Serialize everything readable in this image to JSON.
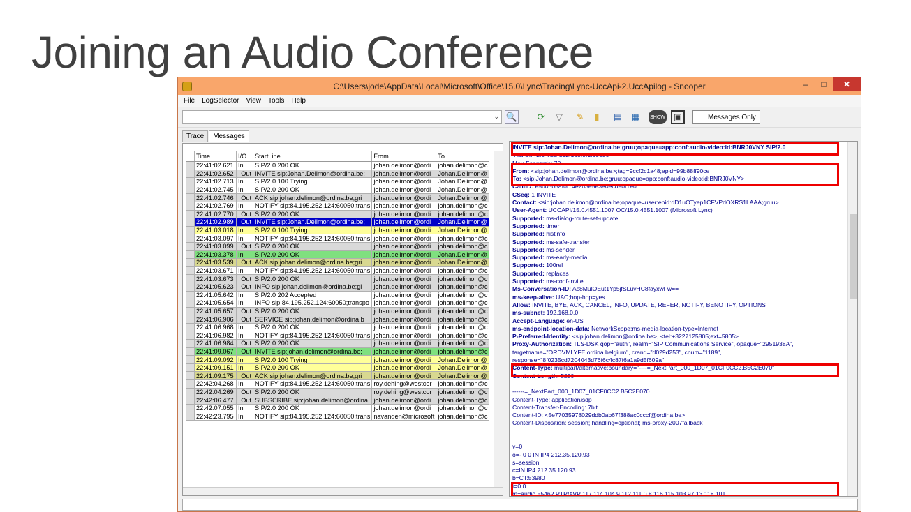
{
  "slide": {
    "title": "Joining an Audio Conference"
  },
  "window": {
    "title": "C:\\Users\\jode\\AppData\\Local\\Microsoft\\Office\\15.0\\Lync\\Tracing\\Lync-UccApi-2.UccApilog - Snooper",
    "minimize": "–",
    "maximize": "□",
    "close": "✕"
  },
  "menu": [
    "File",
    "LogSelector",
    "View",
    "Tools",
    "Help"
  ],
  "toolbar": {
    "messages_only": "Messages Only"
  },
  "tabs": [
    "Trace",
    "Messages"
  ],
  "grid": {
    "columns": [
      "Time",
      "I/O",
      "StartLine",
      "From",
      "To"
    ],
    "rows": [
      {
        "time": "22:41:02.621",
        "io": "In",
        "start": "SIP/2.0 200 OK",
        "from": "johan.delimon@ordi",
        "to": "johan.delimon@c",
        "style": "white"
      },
      {
        "time": "22:41:02.652",
        "io": "Out",
        "start": "INVITE sip:Johan.Delimon@ordina.be;",
        "from": "johan.delimon@ordi",
        "to": "Johan.Delimon@",
        "style": "gray"
      },
      {
        "time": "22:41:02.713",
        "io": "In",
        "start": "SIP/2.0 100 Trying",
        "from": "johan.delimon@ordi",
        "to": "Johan.Delimon@",
        "style": "white"
      },
      {
        "time": "22:41:02.745",
        "io": "In",
        "start": "SIP/2.0 200 OK",
        "from": "johan.delimon@ordi",
        "to": "Johan.Delimon@",
        "style": "white"
      },
      {
        "time": "22:41:02.746",
        "io": "Out",
        "start": "ACK sip:johan.delimon@ordina.be;gri",
        "from": "johan.delimon@ordi",
        "to": "Johan.Delimon@",
        "style": "gray"
      },
      {
        "time": "22:41:02.769",
        "io": "In",
        "start": "NOTIFY sip:84.195.252.124:60050;trans",
        "from": "johan.delimon@ordi",
        "to": "johan.delimon@c",
        "style": "white"
      },
      {
        "time": "22:41:02.770",
        "io": "Out",
        "start": "SIP/2.0 200 OK",
        "from": "johan.delimon@ordi",
        "to": "johan.delimon@c",
        "style": "gray"
      },
      {
        "time": "22:41:02.989",
        "io": "Out",
        "start": "INVITE sip:Johan.Delimon@ordina.be;",
        "from": "johan.delimon@ordi",
        "to": "Johan.Delimon@",
        "style": "blue"
      },
      {
        "time": "22:41:03.018",
        "io": "In",
        "start": "SIP/2.0 100 Trying",
        "from": "johan.delimon@ordi",
        "to": "Johan.Delimon@",
        "style": "yellow"
      },
      {
        "time": "22:41:03.097",
        "io": "In",
        "start": "NOTIFY sip:84.195.252.124:60050;trans",
        "from": "johan.delimon@ordi",
        "to": "johan.delimon@c",
        "style": "white"
      },
      {
        "time": "22:41:03.099",
        "io": "Out",
        "start": "SIP/2.0 200 OK",
        "from": "johan.delimon@ordi",
        "to": "johan.delimon@c",
        "style": "gray"
      },
      {
        "time": "22:41:03.378",
        "io": "In",
        "start": "SIP/2.0 200 OK",
        "from": "johan.delimon@ordi",
        "to": "Johan.Delimon@",
        "style": "green"
      },
      {
        "time": "22:41:03.539",
        "io": "Out",
        "start": "ACK sip:johan.delimon@ordina.be;gri",
        "from": "johan.delimon@ordi",
        "to": "Johan.Delimon@",
        "style": "khaki"
      },
      {
        "time": "22:41:03.671",
        "io": "In",
        "start": "NOTIFY sip:84.195.252.124:60050;trans",
        "from": "johan.delimon@ordi",
        "to": "johan.delimon@c",
        "style": "white"
      },
      {
        "time": "22:41:03.673",
        "io": "Out",
        "start": "SIP/2.0 200 OK",
        "from": "johan.delimon@ordi",
        "to": "johan.delimon@c",
        "style": "gray"
      },
      {
        "time": "22:41:05.623",
        "io": "Out",
        "start": "INFO sip:johan.delimon@ordina.be;gi",
        "from": "johan.delimon@ordi",
        "to": "johan.delimon@c",
        "style": "gray"
      },
      {
        "time": "22:41:05.642",
        "io": "In",
        "start": "SIP/2.0 202 Accepted",
        "from": "johan.delimon@ordi",
        "to": "johan.delimon@c",
        "style": "white"
      },
      {
        "time": "22:41:05.654",
        "io": "In",
        "start": "INFO sip:84.195.252.124:60050;transpo",
        "from": "johan.delimon@ordi",
        "to": "johan.delimon@c",
        "style": "white"
      },
      {
        "time": "22:41:05.657",
        "io": "Out",
        "start": "SIP/2.0 200 OK",
        "from": "johan.delimon@ordi",
        "to": "johan.delimon@c",
        "style": "gray"
      },
      {
        "time": "22:41:06.906",
        "io": "Out",
        "start": "SERVICE sip:johan.delimon@ordina.b",
        "from": "johan.delimon@ordi",
        "to": "johan.delimon@c",
        "style": "gray"
      },
      {
        "time": "22:41:06.968",
        "io": "In",
        "start": "SIP/2.0 200 OK",
        "from": "johan.delimon@ordi",
        "to": "johan.delimon@c",
        "style": "white"
      },
      {
        "time": "22:41:06.982",
        "io": "In",
        "start": "NOTIFY sip:84.195.252.124:60050;trans",
        "from": "johan.delimon@ordi",
        "to": "johan.delimon@c",
        "style": "white"
      },
      {
        "time": "22:41:06.984",
        "io": "Out",
        "start": "SIP/2.0 200 OK",
        "from": "johan.delimon@ordi",
        "to": "johan.delimon@c",
        "style": "gray"
      },
      {
        "time": "22:41:09.067",
        "io": "Out",
        "start": "INVITE sip:johan.delimon@ordina.be;",
        "from": "johan.delimon@ordi",
        "to": "johan.delimon@c",
        "style": "green"
      },
      {
        "time": "22:41:09.092",
        "io": "In",
        "start": "SIP/2.0 100 Trying",
        "from": "johan.delimon@ordi",
        "to": "Johan.Delimon@",
        "style": "yellow"
      },
      {
        "time": "22:41:09.151",
        "io": "In",
        "start": "SIP/2.0 200 OK",
        "from": "johan.delimon@ordi",
        "to": "Johan.Delimon@",
        "style": "yellow"
      },
      {
        "time": "22:41:09.175",
        "io": "Out",
        "start": "ACK sip:johan.delimon@ordina.be;gri",
        "from": "johan.delimon@ordi",
        "to": "Johan.Delimon@",
        "style": "khaki"
      },
      {
        "time": "22:42:04.268",
        "io": "In",
        "start": "NOTIFY sip:84.195.252.124:60050;trans",
        "from": "roy.dehing@westcor",
        "to": "johan.delimon@c",
        "style": "white"
      },
      {
        "time": "22:42:04.269",
        "io": "Out",
        "start": "SIP/2.0 200 OK",
        "from": "roy.dehing@westcor",
        "to": "johan.delimon@c",
        "style": "gray"
      },
      {
        "time": "22:42:06.477",
        "io": "Out",
        "start": "SUBSCRIBE sip:johan.delimon@ordina",
        "from": "johan.delimon@ordi",
        "to": "johan.delimon@c",
        "style": "gray"
      },
      {
        "time": "22:42:07.055",
        "io": "In",
        "start": "SIP/2.0 200 OK",
        "from": "johan.delimon@ordi",
        "to": "johan.delimon@c",
        "style": "white"
      },
      {
        "time": "22:42:23.795",
        "io": "In",
        "start": "NOTIFY sip:84.195.252.124:60050;trans",
        "from": "navanden@microsoft",
        "to": "johan.delimon@c",
        "style": "white"
      }
    ]
  },
  "detail": {
    "lines": [
      {
        "k": "INVITE sip:Johan.Delimon@ordina.be;gruu;opaque=app:conf:audio-video:id:BNRJ0VNY SIP/2.0",
        "v": ""
      },
      {
        "k": "Via:",
        "v": " SIP/2.0/TLS 192.168.0.1:60050"
      },
      {
        "k": "",
        "v": "Max-Forwards: 70"
      },
      {
        "k": "From:",
        "v": " <sip:johan.delimon@ordina.be>;tag=9ccf2c1a48;epid=99b88ff90ce"
      },
      {
        "k": "To:",
        "v": " <sip:Johan.Delimon@ordina.be;gruu;opaque=app:conf:audio-video:id:BNRJ0VNY>"
      },
      {
        "k": "Call-ID:",
        "v": " e5b0305af0f74e2d3e5e3e0ec0e0f1e0"
      },
      {
        "k": "CSeq:",
        "v": " 1 INVITE"
      },
      {
        "k": "Contact:",
        "v": " <sip:johan.delimon@ordina.be;opaque=user:epid:dD1uOTyep1CFVPdOXRS1LAAA;gruu>"
      },
      {
        "k": "User-Agent:",
        "v": " UCCAPI/15.0.4551.1007 OC/15.0.4551.1007 (Microsoft Lync)"
      },
      {
        "k": "Supported:",
        "v": " ms-dialog-route-set-update"
      },
      {
        "k": "Supported:",
        "v": " timer"
      },
      {
        "k": "Supported:",
        "v": " histinfo"
      },
      {
        "k": "Supported:",
        "v": " ms-safe-transfer"
      },
      {
        "k": "Supported:",
        "v": " ms-sender"
      },
      {
        "k": "Supported:",
        "v": " ms-early-media"
      },
      {
        "k": "Supported:",
        "v": " 100rel"
      },
      {
        "k": "Supported:",
        "v": " replaces"
      },
      {
        "k": "Supported:",
        "v": " ms-conf-invite"
      },
      {
        "k": "Ms-Conversation-ID:",
        "v": " Ac8MulOEut1Yp5jfSLuvHC8fayxwFw=="
      },
      {
        "k": "ms-keep-alive:",
        "v": " UAC;hop-hop=yes"
      },
      {
        "k": "Allow:",
        "v": " INVITE, BYE, ACK, CANCEL, INFO, UPDATE, REFER, NOTIFY, BENOTIFY, OPTIONS"
      },
      {
        "k": "ms-subnet:",
        "v": " 192.168.0.0"
      },
      {
        "k": "Accept-Language:",
        "v": " en-US"
      },
      {
        "k": "ms-endpoint-location-data:",
        "v": " NetworkScope;ms-media-location-type=Internet"
      },
      {
        "k": "P-Preferred-Identity:",
        "v": " <sip:johan.delimon@ordina.be>, <tel:+3227125805;ext=5805>"
      },
      {
        "k": "Proxy-Authorization:",
        "v": " TLS-DSK qop=\"auth\", realm=\"SIP Communications Service\", opaque=\"2951938A\","
      },
      {
        "k": "",
        "v": "targetname=\"ORDVMLYFE.ordina.belgium\", crand=\"d029d253\", cnum=\"1189\","
      },
      {
        "k": "",
        "v": "response=\"8f0235cd7204043d76f6c4c87f6a1a9d5f609a\""
      },
      {
        "k": "Content-Type:",
        "v": " multipart/alternative;boundary=\"----=_NextPart_000_1D07_01CF0CC2.B5C2E070\""
      },
      {
        "k": "Content-Length:",
        "v": " 5230"
      },
      {
        "k": "",
        "v": ""
      },
      {
        "k": "",
        "v": "------=_NextPart_000_1D07_01CF0CC2.B5C2E070"
      },
      {
        "k": "",
        "v": "Content-Type: application/sdp"
      },
      {
        "k": "",
        "v": "Content-Transfer-Encoding: 7bit"
      },
      {
        "k": "",
        "v": "Content-ID: <5e77035978029ddb0ab67f388ac0cccf@ordina.be>"
      },
      {
        "k": "",
        "v": "Content-Disposition: session; handling=optional; ms-proxy-2007fallback"
      },
      {
        "k": "",
        "v": ""
      },
      {
        "k": "",
        "v": ""
      },
      {
        "k": "",
        "v": "v=0"
      },
      {
        "k": "",
        "v": "o=- 0 0 IN IP4 212.35.120.93"
      },
      {
        "k": "",
        "v": "s=session"
      },
      {
        "k": "",
        "v": "c=IN IP4 212.35.120.93"
      },
      {
        "k": "",
        "v": "b=CT:53980"
      },
      {
        "k": "",
        "v": "t=0 0"
      },
      {
        "k": "",
        "v": "m=audio 55462 RTP/AVP 117 114 104 9 112 111 0 8 116 115 103 97 13 118 101"
      }
    ]
  },
  "colors": {
    "titlebar": "#f9a66b",
    "highlight_box": "#e00000",
    "detail_text": "#00008b",
    "row_gray": "#d9d9d9",
    "row_blue": "#0000c8",
    "row_yellow": "#ffff99",
    "row_green": "#7fe07f",
    "row_khaki": "#d8d890"
  }
}
